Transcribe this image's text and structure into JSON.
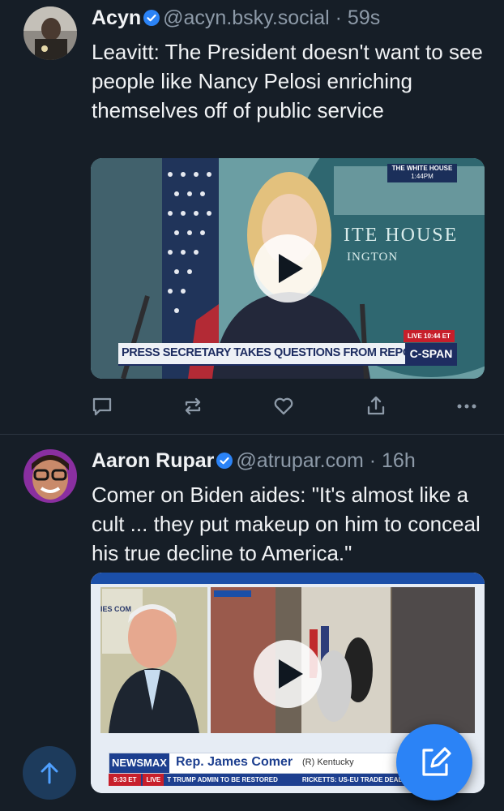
{
  "post1": {
    "author": "Acyn",
    "handle": "@acyn.bsky.social",
    "separator": "·",
    "time": "59s",
    "text": "Leavitt: The President doesn't want to see people like Nancy Pelosi enriching themselves off of public service",
    "video": {
      "bug_title": "THE WHITE HOUSE",
      "bug_time": "1:44PM",
      "podium_text_1": "ITE HOUSE",
      "podium_text_2": "INGTON",
      "live": "LIVE",
      "live_time": "10:44 ET",
      "chyron": "PRESS SECRETARY TAKES QUESTIONS FROM REPORTERS",
      "network": "C-SPAN"
    }
  },
  "post2": {
    "author": "Aaron Rupar",
    "handle": "@atrupar.com",
    "separator": "·",
    "time": "16h",
    "text": "Comer on Biden aides: \"It's almost like a cult ... they put makeup on him to conceal his true decline to America.\"",
    "video": {
      "network": "NEWSMAX",
      "name": "Rep. James Comer",
      "party": "(R) Kentucky",
      "time": "9:33 ET",
      "live": "LIVE",
      "ticker_1": "T TRUMP ADMIN TO BE RESTORED",
      "ticker_2": "RICKETTS: US-EU TRADE DEAL 'GR",
      "sign": "IES COM"
    }
  },
  "colors": {
    "background": "#161e27",
    "accent": "#2b83f6",
    "muted": "#8d9aa8"
  },
  "icons": [
    "verified-badge-icon",
    "reply-icon",
    "repost-icon",
    "like-icon",
    "share-icon",
    "more-icon",
    "play-icon",
    "compose-icon",
    "arrow-up-icon"
  ]
}
